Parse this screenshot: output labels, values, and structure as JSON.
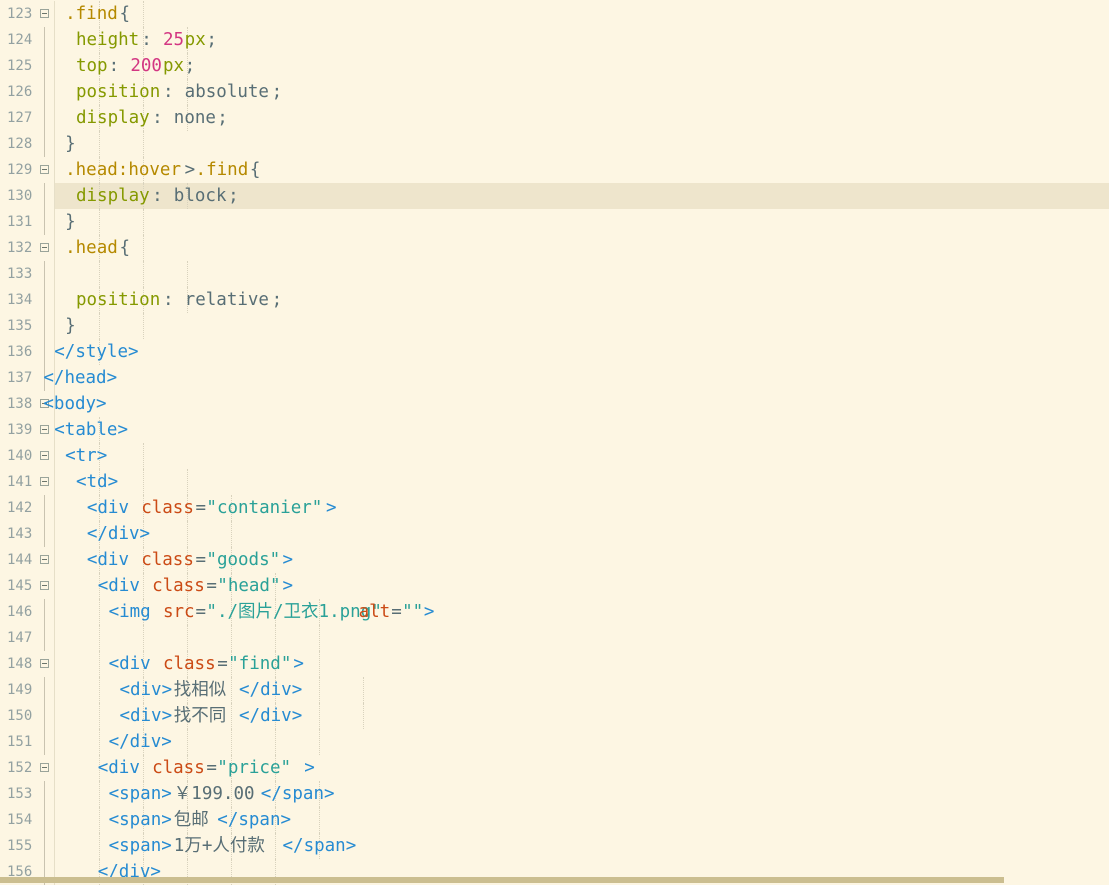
{
  "palette": {
    "background": "#fdf6e3",
    "current_line": "#eee5cc",
    "line_number": "#93a1a1",
    "scrollbar": "#cbbe90"
  },
  "colors": {
    "sel": "#b58900",
    "punc": "#586e75",
    "prop": "#859900",
    "num": "#d33682",
    "txt": "#586e75",
    "tag": "#268bd2",
    "attr": "#cb4b16",
    "str": "#2aa198"
  },
  "lines": [
    {
      "n": "123",
      "fold": "open",
      "guides": [
        1,
        2
      ],
      "tokens": [
        {
          "c": 3,
          "t": ".find",
          "k": "sel"
        },
        {
          "c": 8,
          "t": "{",
          "k": "punc"
        }
      ]
    },
    {
      "n": "124",
      "fold": "mid",
      "guides": [
        1,
        2,
        3
      ],
      "tokens": [
        {
          "c": 4,
          "t": "height",
          "k": "prop"
        },
        {
          "c": 10,
          "t": ":",
          "k": "punc"
        },
        {
          "c": 12,
          "t": "25",
          "k": "num"
        },
        {
          "c": 14,
          "t": "px",
          "k": "prop"
        },
        {
          "c": 16,
          "t": ";",
          "k": "punc"
        }
      ]
    },
    {
      "n": "125",
      "fold": "mid",
      "guides": [
        1,
        2,
        3
      ],
      "tokens": [
        {
          "c": 4,
          "t": "top",
          "k": "prop"
        },
        {
          "c": 7,
          "t": ":",
          "k": "punc"
        },
        {
          "c": 9,
          "t": "200",
          "k": "num"
        },
        {
          "c": 12,
          "t": "px",
          "k": "prop"
        },
        {
          "c": 14,
          "t": ";",
          "k": "punc"
        }
      ]
    },
    {
      "n": "126",
      "fold": "mid",
      "guides": [
        1,
        2,
        3
      ],
      "tokens": [
        {
          "c": 4,
          "t": "position",
          "k": "prop"
        },
        {
          "c": 12,
          "t": ":",
          "k": "punc"
        },
        {
          "c": 14,
          "t": "absolute",
          "k": "txt"
        },
        {
          "c": 22,
          "t": ";",
          "k": "punc"
        }
      ]
    },
    {
      "n": "127",
      "fold": "mid",
      "guides": [
        1,
        2,
        3
      ],
      "tokens": [
        {
          "c": 4,
          "t": "display",
          "k": "prop"
        },
        {
          "c": 11,
          "t": ":",
          "k": "punc"
        },
        {
          "c": 13,
          "t": "none",
          "k": "txt"
        },
        {
          "c": 17,
          "t": ";",
          "k": "punc"
        }
      ]
    },
    {
      "n": "128",
      "fold": "mid",
      "guides": [
        1,
        2
      ],
      "tokens": [
        {
          "c": 3,
          "t": "}",
          "k": "punc"
        }
      ]
    },
    {
      "n": "129",
      "fold": "open",
      "guides": [
        1,
        2
      ],
      "tokens": [
        {
          "c": 3,
          "t": ".head:hover",
          "k": "sel"
        },
        {
          "c": 14,
          "t": ">",
          "k": "punc"
        },
        {
          "c": 15,
          "t": ".find",
          "k": "sel"
        },
        {
          "c": 20,
          "t": "{",
          "k": "punc"
        }
      ]
    },
    {
      "n": "130",
      "fold": "mid",
      "current": true,
      "guides": [
        1,
        2,
        3
      ],
      "tokens": [
        {
          "c": 4,
          "t": "display",
          "k": "prop"
        },
        {
          "c": 11,
          "t": ":",
          "k": "punc"
        },
        {
          "c": 13,
          "t": "block",
          "k": "txt"
        },
        {
          "c": 18,
          "t": ";",
          "k": "punc"
        }
      ]
    },
    {
      "n": "131",
      "fold": "mid",
      "guides": [
        1,
        2
      ],
      "tokens": [
        {
          "c": 3,
          "t": "}",
          "k": "punc"
        }
      ]
    },
    {
      "n": "132",
      "fold": "open",
      "guides": [
        1,
        2
      ],
      "tokens": [
        {
          "c": 3,
          "t": ".head",
          "k": "sel"
        },
        {
          "c": 8,
          "t": "{",
          "k": "punc"
        }
      ]
    },
    {
      "n": "133",
      "fold": "mid",
      "guides": [
        1,
        2,
        3
      ],
      "tokens": []
    },
    {
      "n": "134",
      "fold": "mid",
      "guides": [
        1,
        2,
        3
      ],
      "tokens": [
        {
          "c": 4,
          "t": "position",
          "k": "prop"
        },
        {
          "c": 12,
          "t": ":",
          "k": "punc"
        },
        {
          "c": 14,
          "t": "relative",
          "k": "txt"
        },
        {
          "c": 22,
          "t": ";",
          "k": "punc"
        }
      ]
    },
    {
      "n": "135",
      "fold": "mid",
      "guides": [
        1,
        2
      ],
      "tokens": [
        {
          "c": 3,
          "t": "}",
          "k": "punc"
        }
      ]
    },
    {
      "n": "136",
      "fold": "mid",
      "guides": [
        1
      ],
      "tokens": [
        {
          "c": 2,
          "t": "</style>",
          "k": "tag"
        }
      ]
    },
    {
      "n": "137",
      "fold": "mid",
      "guides": [],
      "tokens": [
        {
          "c": 1,
          "t": "</head>",
          "k": "tag"
        }
      ]
    },
    {
      "n": "138",
      "fold": "open",
      "guides": [],
      "tokens": [
        {
          "c": 1,
          "t": "<body>",
          "k": "tag"
        }
      ]
    },
    {
      "n": "139",
      "fold": "open",
      "guides": [
        1
      ],
      "tokens": [
        {
          "c": 2,
          "t": "<table>",
          "k": "tag"
        }
      ]
    },
    {
      "n": "140",
      "fold": "open",
      "guides": [
        1,
        2
      ],
      "tokens": [
        {
          "c": 3,
          "t": "<tr>",
          "k": "tag"
        }
      ]
    },
    {
      "n": "141",
      "fold": "open",
      "guides": [
        1,
        2,
        3
      ],
      "tokens": [
        {
          "c": 4,
          "t": "<td>",
          "k": "tag"
        }
      ]
    },
    {
      "n": "142",
      "fold": "mid",
      "guides": [
        1,
        2,
        3,
        4
      ],
      "tokens": [
        {
          "c": 5,
          "t": "<div",
          "k": "tag"
        },
        {
          "c": 10,
          "t": "class",
          "k": "attr"
        },
        {
          "c": 15,
          "t": "=",
          "k": "punc"
        },
        {
          "c": 16,
          "t": "\"contanier\"",
          "k": "str"
        },
        {
          "c": 27,
          "t": ">",
          "k": "tag"
        }
      ]
    },
    {
      "n": "143",
      "fold": "mid",
      "guides": [
        1,
        2,
        3,
        4
      ],
      "tokens": [
        {
          "c": 5,
          "t": "</div>",
          "k": "tag"
        }
      ]
    },
    {
      "n": "144",
      "fold": "open",
      "guides": [
        1,
        2,
        3,
        4
      ],
      "tokens": [
        {
          "c": 5,
          "t": "<div",
          "k": "tag"
        },
        {
          "c": 10,
          "t": "class",
          "k": "attr"
        },
        {
          "c": 15,
          "t": "=",
          "k": "punc"
        },
        {
          "c": 16,
          "t": "\"goods\"",
          "k": "str"
        },
        {
          "c": 23,
          "t": ">",
          "k": "tag"
        }
      ]
    },
    {
      "n": "145",
      "fold": "open",
      "guides": [
        1,
        2,
        3,
        4,
        5
      ],
      "tokens": [
        {
          "c": 6,
          "t": "<div",
          "k": "tag"
        },
        {
          "c": 11,
          "t": "class",
          "k": "attr"
        },
        {
          "c": 16,
          "t": "=",
          "k": "punc"
        },
        {
          "c": 17,
          "t": "\"head\"",
          "k": "str"
        },
        {
          "c": 23,
          "t": ">",
          "k": "tag"
        }
      ]
    },
    {
      "n": "146",
      "fold": "mid",
      "guides": [
        1,
        2,
        3,
        4,
        5,
        6
      ],
      "tokens": [
        {
          "c": 7,
          "t": "<img",
          "k": "tag"
        },
        {
          "c": 12,
          "t": "src",
          "k": "attr"
        },
        {
          "c": 15,
          "t": "=",
          "k": "punc"
        },
        {
          "c": 16,
          "t": "\"./图片/卫衣1.png\"",
          "k": "str"
        },
        {
          "c": 30,
          "t": "alt",
          "k": "attr"
        },
        {
          "c": 33,
          "t": "=",
          "k": "punc"
        },
        {
          "c": 34,
          "t": "\"\"",
          "k": "str"
        },
        {
          "c": 36,
          "t": ">",
          "k": "tag"
        }
      ]
    },
    {
      "n": "147",
      "fold": "mid",
      "guides": [
        1,
        2,
        3,
        4,
        5,
        6
      ],
      "tokens": []
    },
    {
      "n": "148",
      "fold": "open",
      "guides": [
        1,
        2,
        3,
        4,
        5,
        6
      ],
      "tokens": [
        {
          "c": 7,
          "t": "<div",
          "k": "tag"
        },
        {
          "c": 12,
          "t": "class",
          "k": "attr"
        },
        {
          "c": 17,
          "t": "=",
          "k": "punc"
        },
        {
          "c": 18,
          "t": "\"find\"",
          "k": "str"
        },
        {
          "c": 24,
          "t": ">",
          "k": "tag"
        }
      ]
    },
    {
      "n": "149",
      "fold": "mid",
      "guides": [
        1,
        2,
        3,
        4,
        5,
        6,
        7
      ],
      "tokens": [
        {
          "c": 8,
          "t": "<div>",
          "k": "tag"
        },
        {
          "c": 13,
          "t": "找相似",
          "k": "txt"
        },
        {
          "c": 19,
          "t": "</div>",
          "k": "tag"
        }
      ]
    },
    {
      "n": "150",
      "fold": "mid",
      "guides": [
        1,
        2,
        3,
        4,
        5,
        6,
        7
      ],
      "tokens": [
        {
          "c": 8,
          "t": "<div>",
          "k": "tag"
        },
        {
          "c": 13,
          "t": "找不同",
          "k": "txt"
        },
        {
          "c": 19,
          "t": "</div>",
          "k": "tag"
        }
      ]
    },
    {
      "n": "151",
      "fold": "mid",
      "guides": [
        1,
        2,
        3,
        4,
        5,
        6
      ],
      "tokens": [
        {
          "c": 7,
          "t": "</div>",
          "k": "tag"
        }
      ]
    },
    {
      "n": "152",
      "fold": "open",
      "guides": [
        1,
        2,
        3,
        4,
        5
      ],
      "tokens": [
        {
          "c": 6,
          "t": "<div",
          "k": "tag"
        },
        {
          "c": 11,
          "t": "class",
          "k": "attr"
        },
        {
          "c": 16,
          "t": "=",
          "k": "punc"
        },
        {
          "c": 17,
          "t": "\"price\"",
          "k": "str"
        },
        {
          "c": 25,
          "t": ">",
          "k": "tag"
        }
      ]
    },
    {
      "n": "153",
      "fold": "mid",
      "guides": [
        1,
        2,
        3,
        4,
        5,
        6
      ],
      "tokens": [
        {
          "c": 7,
          "t": "<span>",
          "k": "tag"
        },
        {
          "c": 13,
          "t": "￥199.00",
          "k": "txt"
        },
        {
          "c": 21,
          "t": "</span>",
          "k": "tag"
        }
      ]
    },
    {
      "n": "154",
      "fold": "mid",
      "guides": [
        1,
        2,
        3,
        4,
        5,
        6
      ],
      "tokens": [
        {
          "c": 7,
          "t": "<span>",
          "k": "tag"
        },
        {
          "c": 13,
          "t": "包邮",
          "k": "txt"
        },
        {
          "c": 17,
          "t": "</span>",
          "k": "tag"
        }
      ]
    },
    {
      "n": "155",
      "fold": "mid",
      "guides": [
        1,
        2,
        3,
        4,
        5,
        6
      ],
      "tokens": [
        {
          "c": 7,
          "t": "<span>",
          "k": "tag"
        },
        {
          "c": 13,
          "t": "1万+人付款",
          "k": "txt"
        },
        {
          "c": 23,
          "t": "</span>",
          "k": "tag"
        }
      ]
    },
    {
      "n": "156",
      "fold": "mid",
      "guides": [
        1,
        2,
        3,
        4,
        5
      ],
      "tokens": [
        {
          "c": 6,
          "t": "</div>",
          "k": "tag"
        }
      ]
    }
  ]
}
